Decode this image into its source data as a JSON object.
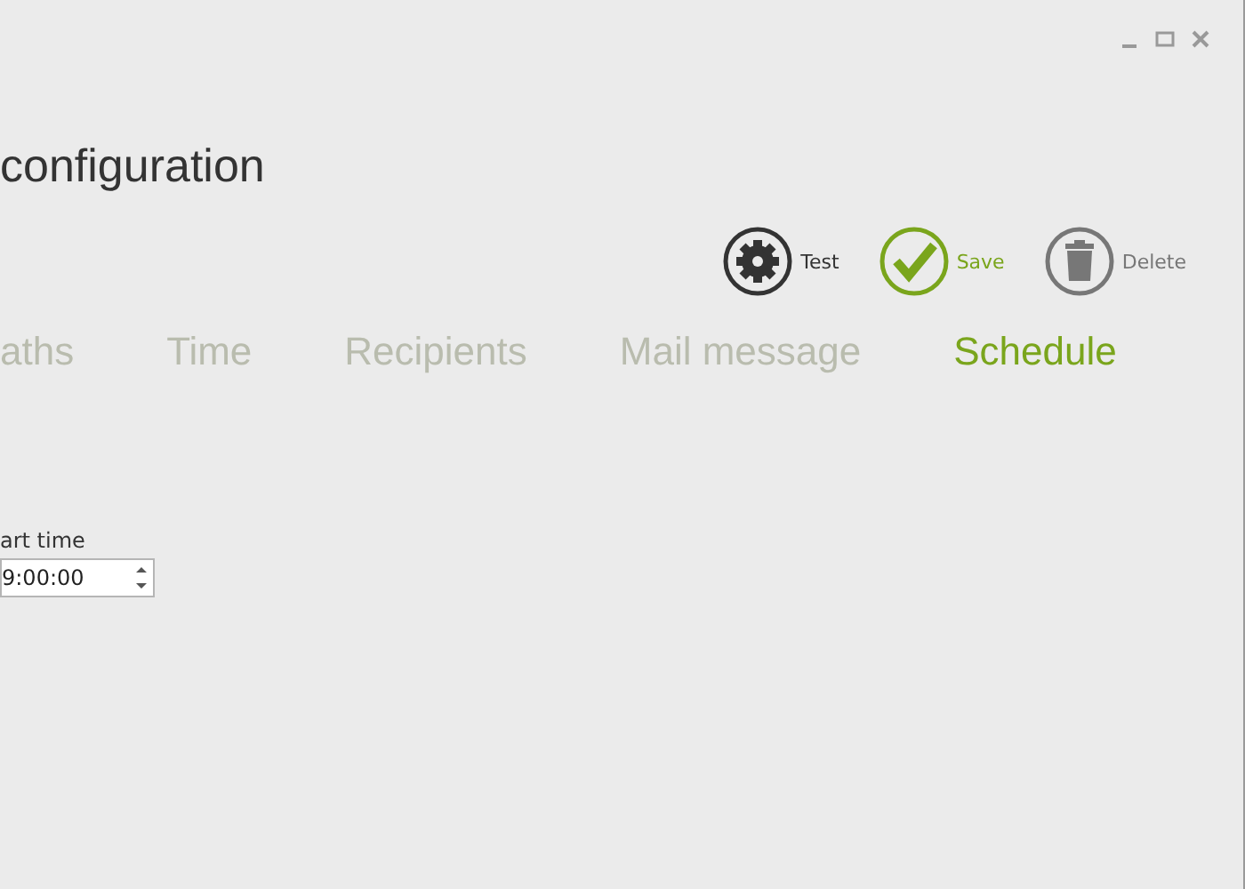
{
  "title": "configuration",
  "actions": [
    {
      "kind": "gear",
      "label": "Test",
      "color": "#333333"
    },
    {
      "kind": "check",
      "label": "Save",
      "color": "#7aa51c"
    },
    {
      "kind": "trash",
      "label": "Delete",
      "color": "#777777"
    }
  ],
  "tabs": [
    {
      "label": "aths",
      "selected": false
    },
    {
      "label": "Time",
      "selected": false
    },
    {
      "label": "Recipients",
      "selected": false
    },
    {
      "label": "Mail message",
      "selected": false
    },
    {
      "label": "Schedule",
      "selected": true
    }
  ],
  "start_time": {
    "label": "art time",
    "value": "9:00:00"
  }
}
